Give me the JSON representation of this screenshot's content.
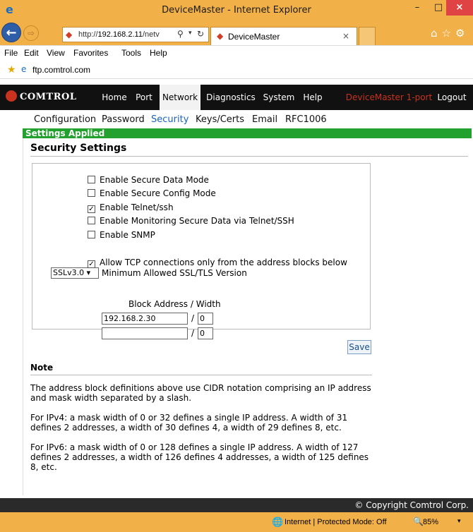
{
  "window": {
    "title": "DeviceMaster - Internet Explorer",
    "min": "–",
    "max": "□",
    "close": "×"
  },
  "browser": {
    "address_prefix": "http://",
    "address_host": "192.168.2.11",
    "address_suffix": "/netv",
    "tab_label": "DeviceMaster",
    "tab_close": "×"
  },
  "menu": {
    "file": "File",
    "edit": "Edit",
    "view": "View",
    "favorites": "Favorites",
    "tools": "Tools",
    "help": "Help"
  },
  "favorites_bar": {
    "link": "ftp.comtrol.com"
  },
  "topnav": {
    "logo": "COMTROL",
    "tabs": [
      "Home",
      "Port",
      "Network",
      "Diagnostics",
      "System",
      "Help"
    ],
    "device": "DeviceMaster 1-port",
    "logout": "Logout"
  },
  "subnav": {
    "items": [
      "Configuration",
      "Password",
      "Security",
      "Keys/Certs",
      "Email",
      "RFC1006"
    ]
  },
  "status_banner": "Settings Applied",
  "security": {
    "title": "Security Settings",
    "options": [
      {
        "label": "Enable Secure Data Mode",
        "checked": false,
        "mark": ""
      },
      {
        "label": "Enable Secure Config Mode",
        "checked": false,
        "mark": ""
      },
      {
        "label": "Enable Telnet/ssh",
        "checked": true,
        "mark": "✓"
      },
      {
        "label": "Enable Monitoring Secure Data via Telnet/SSH",
        "checked": false,
        "mark": ""
      },
      {
        "label": "Enable SNMP",
        "checked": false,
        "mark": ""
      }
    ],
    "ssl_select_value": "SSLv3.0",
    "ssl_label": "Minimum Allowed SSL/TLS Version",
    "allow_tcp": {
      "label": "Allow TCP connections only from the address blocks below",
      "checked": true,
      "mark": "✓"
    },
    "block_header": "Block Address / Width",
    "blocks": [
      {
        "address": "192.168.2.30",
        "width": "0"
      },
      {
        "address": "",
        "width": "0"
      }
    ],
    "slash": "/",
    "save": "Save"
  },
  "note": {
    "title": "Note",
    "paragraphs": [
      "The address block definitions above use CIDR notation comprising an IP address and mask width separated by a slash.",
      "For IPv4: a mask width of 0 or 32 defines a single IP address. A width of 31 defines 2 addresses, a width of 30 defines 4, a width of 29 defines 8, etc.",
      "For IPv6: a mask width of 0 or 128 defines a single IP address. A width of 127 defines 2 addresses, a width of 126 defines 4 addresses, a width of 125 defines 8, etc."
    ]
  },
  "copyright": "© Copyright Comtrol Corp.",
  "statusbar": {
    "text": "Internet | Protected Mode: Off",
    "zoom": "85%"
  }
}
